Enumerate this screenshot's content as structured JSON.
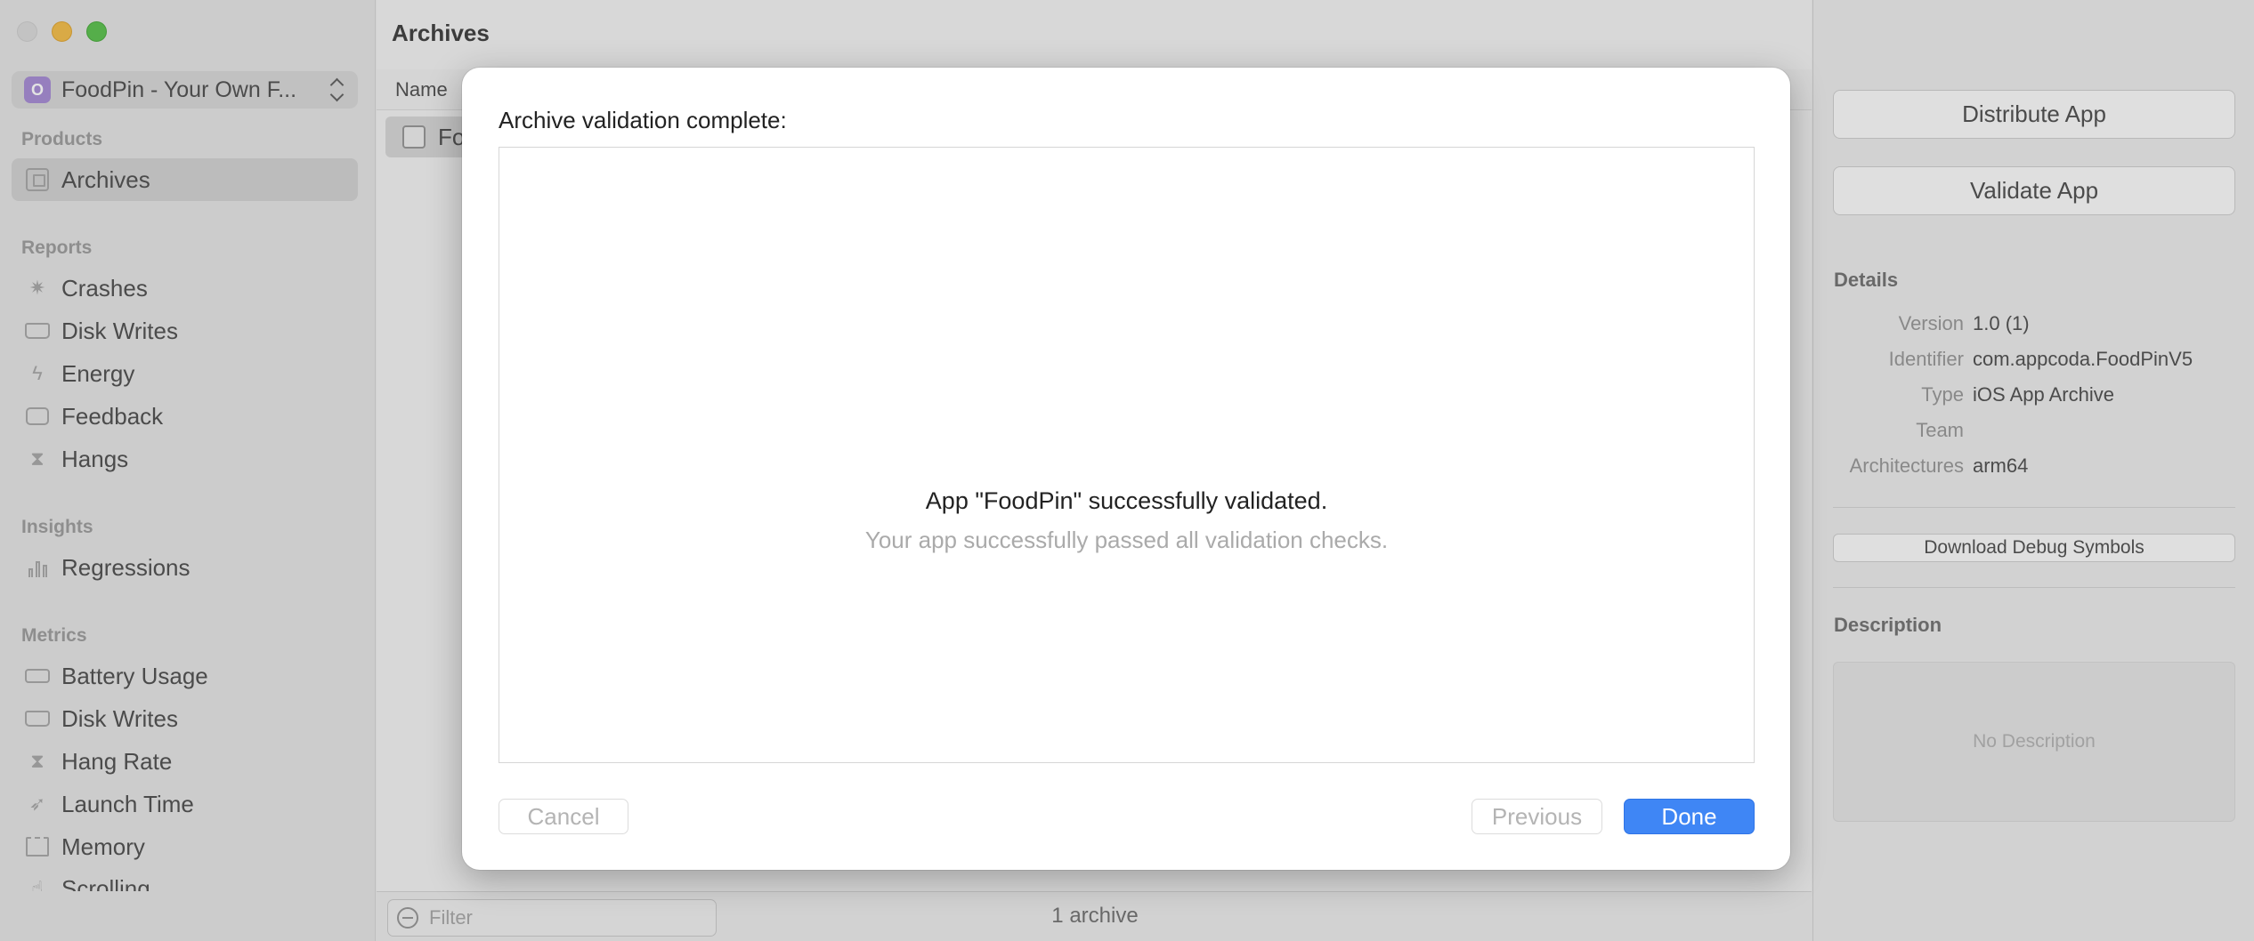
{
  "sidebar": {
    "scheme": {
      "icon_letter": "O",
      "label": "FoodPin - Your Own F..."
    },
    "sections": {
      "products": "Products",
      "reports": "Reports",
      "insights": "Insights",
      "metrics": "Metrics"
    },
    "items": {
      "archives": "Archives",
      "crashes": "Crashes",
      "disk_writes_reports": "Disk Writes",
      "energy": "Energy",
      "feedback": "Feedback",
      "hangs": "Hangs",
      "regressions": "Regressions",
      "battery_usage": "Battery Usage",
      "disk_writes_metrics": "Disk Writes",
      "hang_rate": "Hang Rate",
      "launch_time": "Launch Time",
      "memory": "Memory",
      "scrolling": "Scrolling"
    }
  },
  "main": {
    "title": "Archives",
    "column_name": "Name",
    "row_label": "Fo",
    "filter_placeholder": "Filter",
    "count": "1 archive"
  },
  "inspector": {
    "distribute_label": "Distribute App",
    "validate_label": "Validate App",
    "details_title": "Details",
    "details": [
      {
        "key": "Version",
        "value": "1.0 (1)"
      },
      {
        "key": "Identifier",
        "value": "com.appcoda.FoodPinV5"
      },
      {
        "key": "Type",
        "value": "iOS App Archive"
      },
      {
        "key": "Team",
        "value": ""
      },
      {
        "key": "Architectures",
        "value": "arm64"
      }
    ],
    "download_symbols_label": "Download Debug Symbols",
    "description_title": "Description",
    "description_placeholder": "No Description"
  },
  "sheet": {
    "title": "Archive validation complete:",
    "result_main": "App \"FoodPin\" successfully validated.",
    "result_sub": "Your app successfully passed all validation checks.",
    "cancel_label": "Cancel",
    "previous_label": "Previous",
    "done_label": "Done"
  },
  "colors": {
    "accent": "#3f86f5",
    "window_close": "#dcdcdc",
    "window_minimize": "#f4bf4f",
    "window_maximize": "#60c454"
  }
}
